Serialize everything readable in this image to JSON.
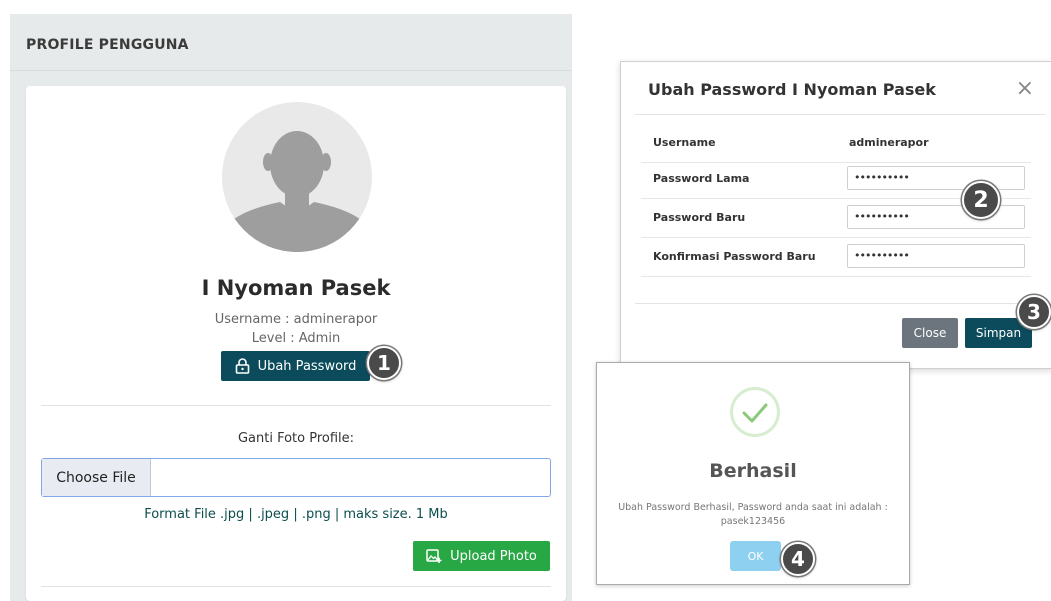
{
  "profile_panel": {
    "title": "PROFILE PENGGUNA",
    "name": "I Nyoman Pasek",
    "username_line": "Username : adminerapor",
    "level_line": "Level : Admin",
    "change_password_label": "Ubah Password",
    "change_photo_label": "Ganti Foto Profile:",
    "choose_file_label": "Choose File",
    "format_hint": "Format File .jpg | .jpeg | .png | maks size. 1 Mb",
    "upload_label": "Upload Photo"
  },
  "password_modal": {
    "title": "Ubah Password I Nyoman Pasek",
    "close_glyph": "×",
    "username_label": "Username",
    "username_value": "adminerapor",
    "old_password_label": "Password Lama",
    "old_password_value": "••••••••••",
    "new_password_label": "Password Baru",
    "new_password_value": "••••••••••",
    "confirm_password_label": "Konfirmasi Password Baru",
    "confirm_password_value": "••••••••••",
    "close_button": "Close",
    "save_button": "Simpan"
  },
  "success_dialog": {
    "title": "Berhasil",
    "message": "Ubah Password Berhasil, Password anda saat ini adalah : pasek123456",
    "ok_button": "OK"
  },
  "markers": [
    "1",
    "2",
    "3",
    "4"
  ],
  "colors": {
    "primary": "#0b4b5b",
    "success": "#28a745",
    "secondary": "#6c757d",
    "ok_button": "#8ed0ef",
    "panel_bg": "#e6eaea"
  }
}
